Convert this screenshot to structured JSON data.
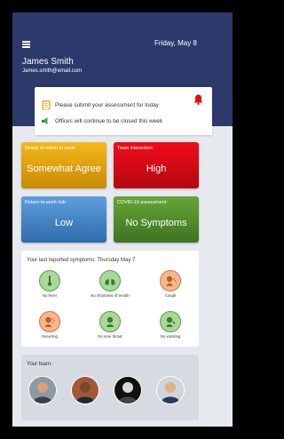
{
  "header": {
    "menu_icon": "hamburger-icon",
    "date": "Friday, May 8",
    "user_name": "James Smith",
    "user_email": "James.smith@email.com"
  },
  "notifications": [
    {
      "icon": "clipboard-icon",
      "text": "Please submit your assessment for today",
      "action_icon": "bell-icon"
    },
    {
      "icon": "megaphone-icon",
      "text": "Offices will continue to be closed this week"
    }
  ],
  "status_cards": [
    {
      "label": "Ready to return to work:",
      "value": "Somewhat Agree",
      "color": "#e5a50f"
    },
    {
      "label": "Team interaction:",
      "value": "High",
      "color": "#e10a15"
    },
    {
      "label": "Return-to-work risk:",
      "value": "Low",
      "color": "#4a88c7"
    },
    {
      "label": "COVID-19 assessment:",
      "value": "No Symptoms",
      "color": "#558f2c"
    }
  ],
  "symptoms": {
    "title": "Your last reported symptoms: Thursday May 7",
    "items": [
      {
        "label": "No fever",
        "state": "ok",
        "icon": "thermometer-icon"
      },
      {
        "label": "No shortness of breath",
        "state": "ok",
        "icon": "lungs-icon"
      },
      {
        "label": "Cough",
        "state": "reported",
        "icon": "cough-icon"
      },
      {
        "label": "Sneezing",
        "state": "reported",
        "icon": "sneeze-icon"
      },
      {
        "label": "No sore throat",
        "state": "ok",
        "icon": "throat-icon"
      },
      {
        "label": "No vomiting",
        "state": "ok",
        "icon": "vomit-icon"
      }
    ]
  },
  "team": {
    "title": "Your team:",
    "members": [
      {
        "icon": "avatar-photo"
      },
      {
        "icon": "avatar-photo"
      },
      {
        "icon": "avatar-photo"
      },
      {
        "icon": "avatar-photo"
      }
    ]
  }
}
